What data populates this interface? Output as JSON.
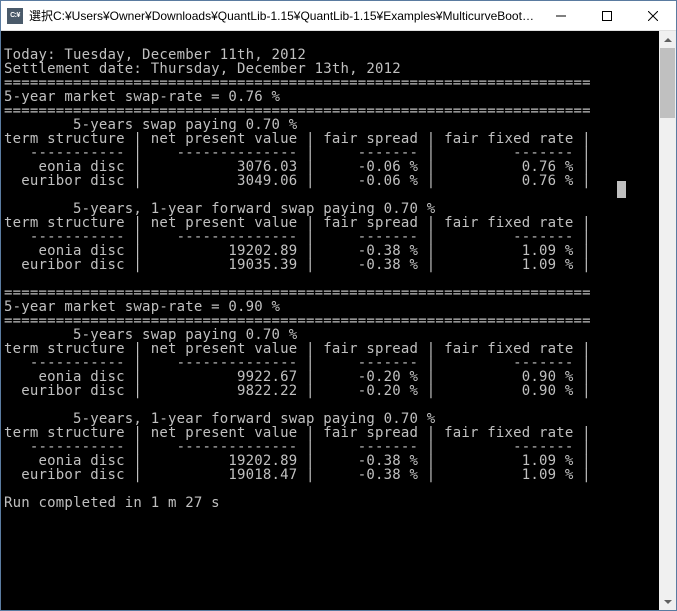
{
  "window": {
    "icon_text": "C:¥",
    "title": "選択C:¥Users¥Owner¥Downloads¥QuantLib-1.15¥QuantLib-1.15¥Examples¥MulticurveBootstra..."
  },
  "console": {
    "today": "Today: Tuesday, December 11th, 2012",
    "settlement": "Settlement date: Thursday, December 13th, 2012",
    "hrule": "====================================================================",
    "swap_rate_1": "5-year market swap-rate = 0.76 %",
    "swap_rate_2": "5-year market swap-rate = 0.90 %",
    "sec1_title": "        5-years swap paying 0.70 %",
    "sec2_title": "        5-years, 1-year forward swap paying 0.70 %",
    "header_row": "term structure | net present value | fair spread | fair fixed rate |",
    "dash_row": "   ----------- |    -------------- |     ------- |         ------- |",
    "r1a": "    eonia disc |           3076.03 |     -0.06 % |          0.76 % |",
    "r1b": "  euribor disc |           3049.06 |     -0.06 % |          0.76 % |",
    "r2a": "    eonia disc |          19202.89 |     -0.38 % |          1.09 % |",
    "r2b": "  euribor disc |          19035.39 |     -0.38 % |          1.09 % |",
    "r3a": "    eonia disc |           9922.67 |     -0.20 % |          0.90 % |",
    "r3b": "  euribor disc |           9822.22 |     -0.20 % |          0.90 % |",
    "r4a": "    eonia disc |          19202.89 |     -0.38 % |          1.09 % |",
    "r4b": "  euribor disc |          19018.47 |     -0.38 % |          1.09 % |",
    "run_completed": "Run completed in 1 m 27 s"
  }
}
